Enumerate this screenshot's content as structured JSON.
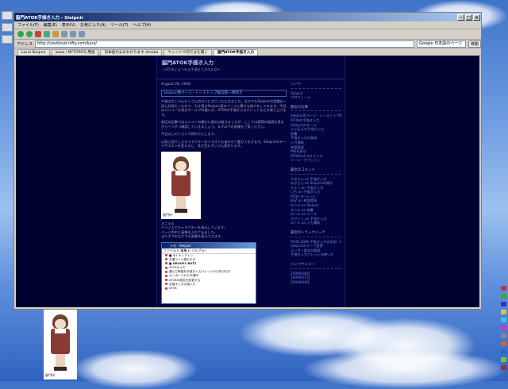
{
  "browser": {
    "window_title": "脇門ATOK手描き入力 - Sleipnir",
    "menu": [
      "ファイル(F)",
      "編集(E)",
      "表示(V)",
      "お気に入り(A)",
      "ツール(T)",
      "ヘルプ(H)"
    ],
    "address_label": "アドレス",
    "address": "http://coutloud.nifty.com/kyui/",
    "search_value": "Google 日本語のページ",
    "go_label": "移動",
    "tabs": [
      "Local Sleipnir",
      "www / MYTOPICS 用語",
      "日本語がよみわかります Ameba",
      "ウィンドウ内でまた開く",
      "脇門ATOK手描き入力"
    ]
  },
  "blog": {
    "title": "脇門ATOK手描き入力",
    "description": "〜ATOKにまつわる手描き入力のお話〜",
    "date": "August 28, 2006",
    "post_title": "Sleipnir用ページ・レーストップ解説第一弾続き",
    "para1": "今週はずいぶんたくさんのひとにきていただきました。なかでもSleipnirの話題は一段と好評だったので、引き続きSleipnir用のページに関する紹介をしてみます。今回はメニューの見方やヘルプの使い方、ATOKの手描き入力パレットなどを取り上げます。",
    "para2": "前回の記事ではメニューの細かい部分は省きましたが、ここでは実際の画面を見ながら一つずつ確認していきましょう。まずは下の画像をご覧ください。",
    "para3": "今日はこのぐらいで終わりにします。",
    "para4": "以前に紹介したキャラクターのイラストもあわせて載せておきます。Sleipnirのテーマやスキンを変えると、見た目もずいぶん変わります。",
    "caption1": "きこえる",
    "caption2": "ページ上でキャラクターを表示しています。",
    "caption3": "ページの中に画像を入れてみました。",
    "caption4": "またタブのなかでも画像を表示できます。",
    "signature": "脇門梓",
    "mini": {
      "title": "メモ - Sleipnir",
      "menu": "ファイル(F)  編集(E)  ヘルプ(H)",
      "rows": [
        "■ IE7 オンライン",
        "共通ページ表示する",
        "■ GROUP1 BUT2",
        "ATOKのメモ",
        "選んだ単語を手描き入力パレットから呼び出す",
        "キーボードからの操作",
        "ATOKの設定を変更する",
        "手描き入力の使い方",
        "ATOK"
      ]
    }
  },
  "sidebar": {
    "links_header": "リンク",
    "links": [
      "Sleipnir",
      "プロフィール"
    ],
    "recent_header": "最近の記事",
    "recent": [
      "Sleipnir用ページ・レーストップ解説第一弾",
      "ATOKの手描き入力",
      "Sleipnirのテーマ",
      "人に伝える手描き入力",
      "辞書",
      "手描き入力の基本",
      "入力補助",
      "単語登録",
      "IMEの表示",
      "ATOKのカスタマイズ",
      "ツール・オプション"
    ],
    "comments_header": "最近のコメント",
    "comments": [
      "りのさん on 手描き入力",
      "ゆきさん on Sleipnirの操作",
      "たろう on 手描き入力",
      "いち on 手描き入力",
      "ATOK on ツール",
      "KAZ on 単語登録",
      "ゆうき on Sleipnir",
      "きりん on 辞書",
      "ロール on ツール",
      "ホワイト on 手描き入力",
      "ロール on 入力補助"
    ],
    "trackback_header": "最近のトラックバック",
    "trackbacks": [
      "ATOK 2006 手描き入力の応用 - Sleipnir",
      "Sleipnirのテーマ変更",
      "ユーザー設定の解説",
      "手描き入力パレットの使い方"
    ],
    "backnumber_header": "バックナンバー",
    "backnumbers": [
      "2006年08月",
      "2006年07月",
      "2006年06月"
    ]
  }
}
